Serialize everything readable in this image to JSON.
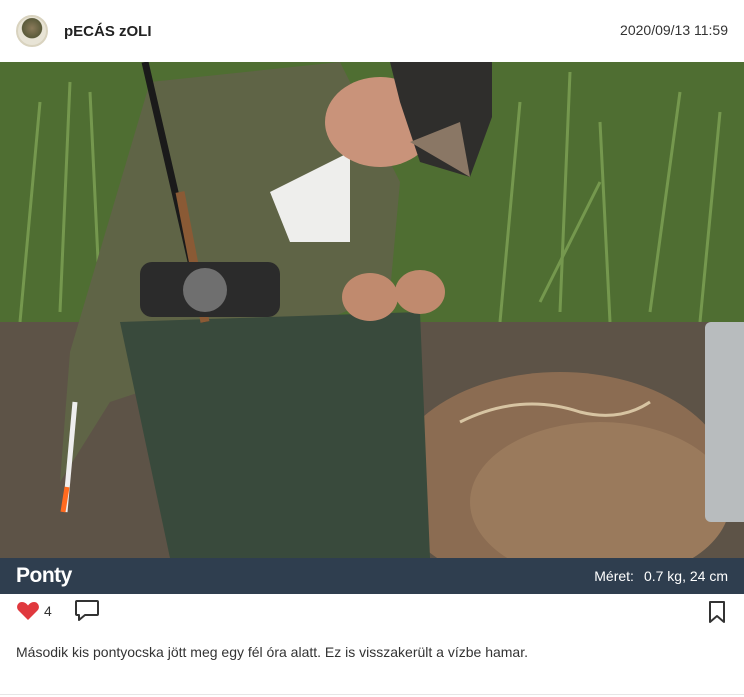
{
  "post": {
    "author": "pECÁS zOLI",
    "timestamp": "2020/09/13 11:59",
    "species": "Ponty",
    "meta_label": "Méret:",
    "meta_value": "0.7 kg, 24 cm",
    "likes": "4",
    "caption": "Második kis pontyocska jött meg egy fél óra alatt. Ez is visszakerült a vízbe hamar."
  },
  "icons": {
    "like": "heart-icon",
    "comment": "comment-icon",
    "save": "bookmark-icon"
  },
  "colors": {
    "title_bar": "#2f3e4f",
    "heart": "#e0393e"
  }
}
